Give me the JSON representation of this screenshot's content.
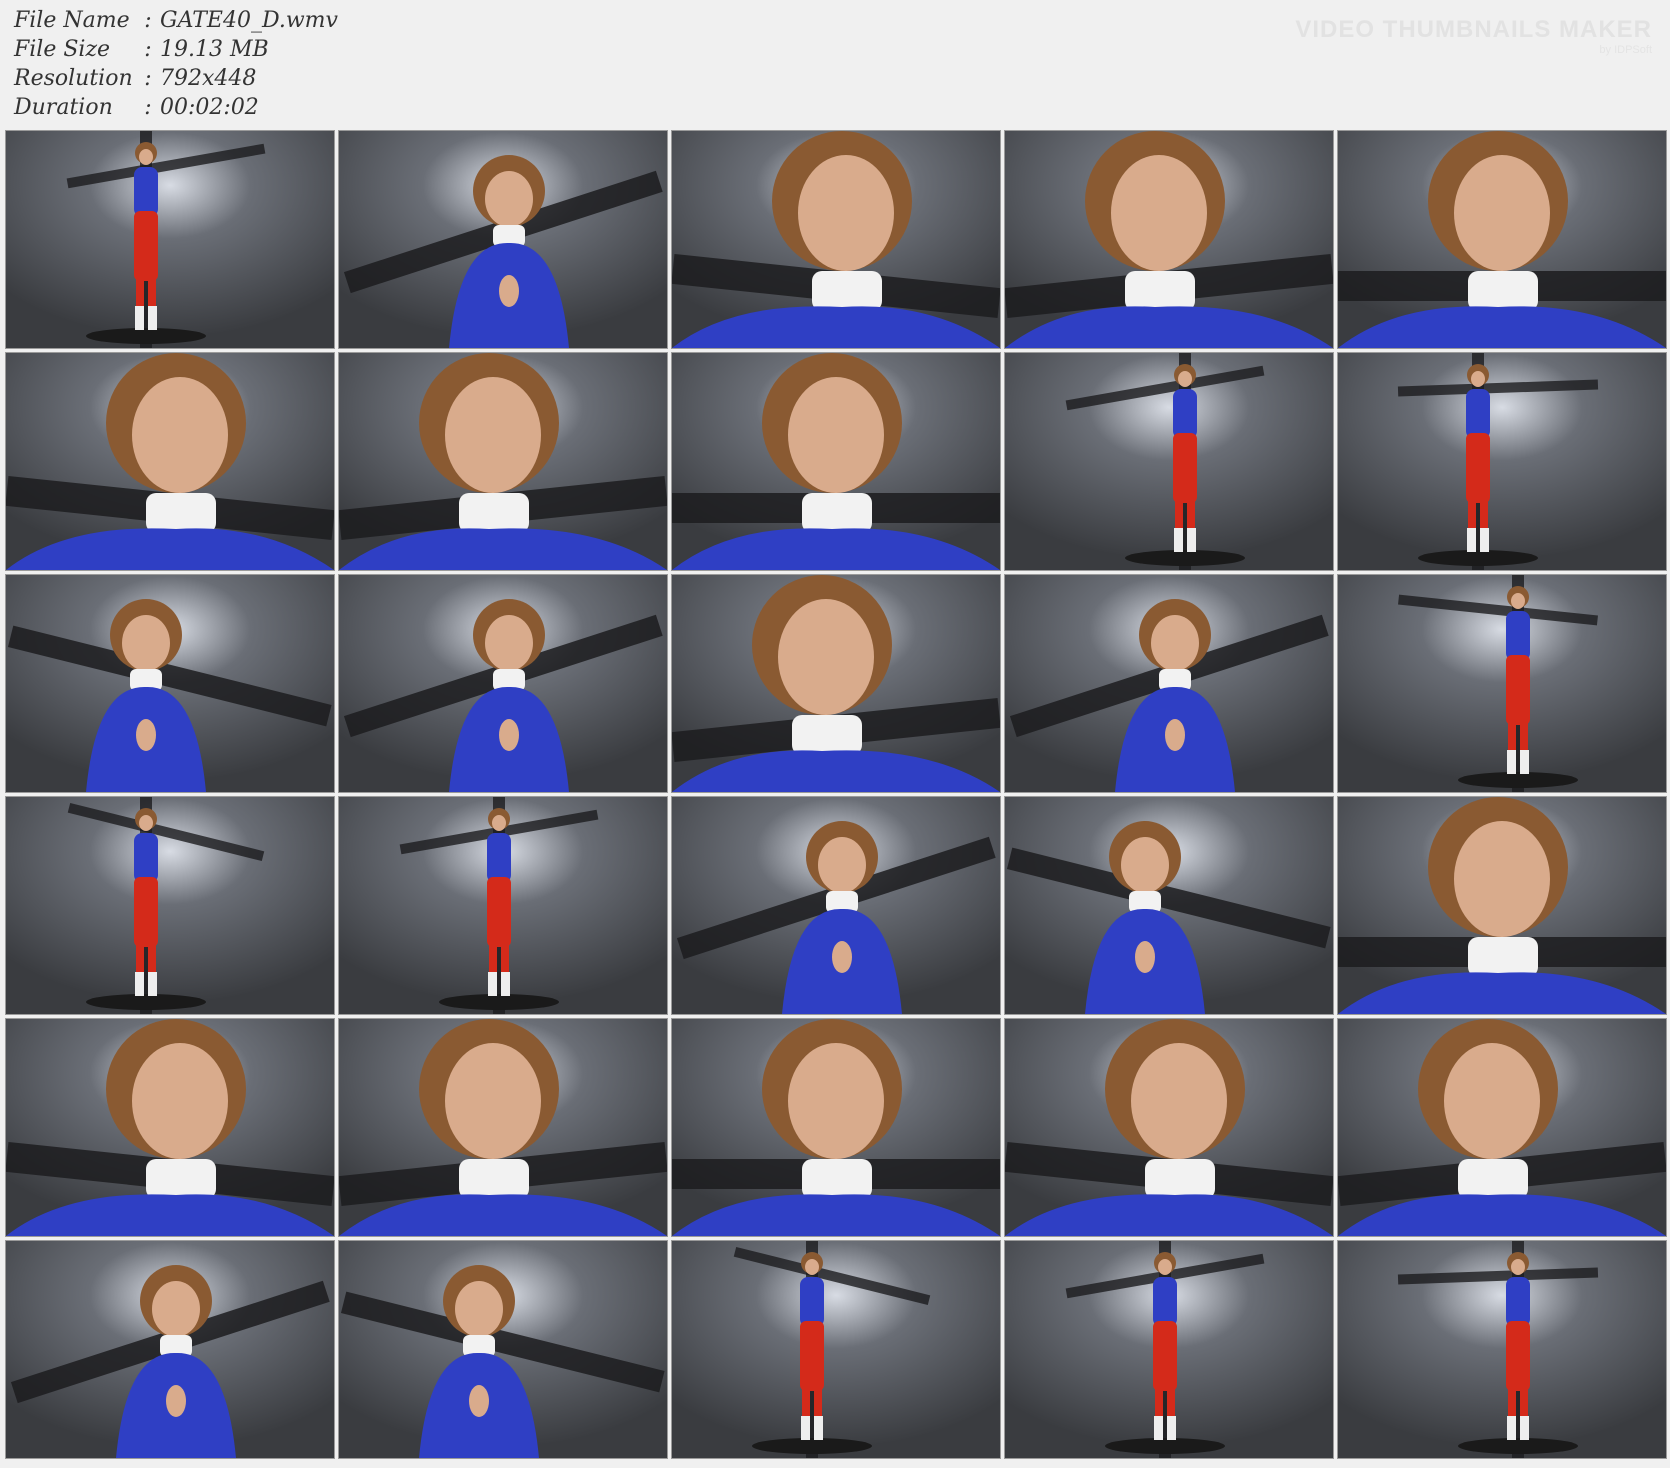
{
  "file_info": [
    {
      "label": "File Name",
      "sep": ":",
      "value": "GATE40_D.wmv"
    },
    {
      "label": "File Size",
      "sep": ":",
      "value": "19.13 MB"
    },
    {
      "label": "Resolution",
      "sep": ":",
      "value": "792x448"
    },
    {
      "label": "Duration",
      "sep": ":",
      "value": "00:02:02"
    }
  ],
  "watermark": {
    "title": "VIDEO THUMBNAILS MAKER",
    "sub": "by IDPSoft"
  },
  "colors": {
    "background": "#f0f0f0",
    "suit_blue": "#2f3fc4",
    "suit_red": "#d42a1a",
    "hair": "#8a5a32",
    "skin": "#d9ab8c",
    "wall": "#3a3c40",
    "beam": "#1c1c1e"
  },
  "thumbnails": [
    {
      "shot": "full"
    },
    {
      "shot": "mid"
    },
    {
      "shot": "face"
    },
    {
      "shot": "face"
    },
    {
      "shot": "face"
    },
    {
      "shot": "face"
    },
    {
      "shot": "face"
    },
    {
      "shot": "face"
    },
    {
      "shot": "full"
    },
    {
      "shot": "full"
    },
    {
      "shot": "mid"
    },
    {
      "shot": "mid"
    },
    {
      "shot": "face"
    },
    {
      "shot": "mid"
    },
    {
      "shot": "full"
    },
    {
      "shot": "full"
    },
    {
      "shot": "full"
    },
    {
      "shot": "mid"
    },
    {
      "shot": "mid"
    },
    {
      "shot": "face"
    },
    {
      "shot": "face"
    },
    {
      "shot": "face"
    },
    {
      "shot": "face"
    },
    {
      "shot": "face"
    },
    {
      "shot": "face"
    },
    {
      "shot": "mid"
    },
    {
      "shot": "mid"
    },
    {
      "shot": "full"
    },
    {
      "shot": "full"
    },
    {
      "shot": "full"
    }
  ]
}
